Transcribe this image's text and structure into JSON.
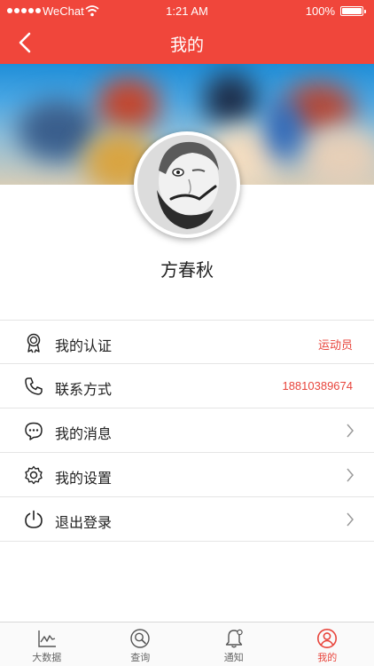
{
  "status_bar": {
    "carrier": "WeChat",
    "time": "1:21 AM",
    "battery": "100%"
  },
  "nav": {
    "title": "我的"
  },
  "profile": {
    "name": "方春秋"
  },
  "menu": {
    "items": [
      {
        "label": "我的认证",
        "value": "运动员",
        "icon": "certificate-icon"
      },
      {
        "label": "联系方式",
        "value": "18810389674",
        "icon": "phone-icon"
      },
      {
        "label": "我的消息",
        "value": "",
        "icon": "message-icon"
      },
      {
        "label": "我的设置",
        "value": "",
        "icon": "gear-icon"
      },
      {
        "label": "退出登录",
        "value": "",
        "icon": "power-icon"
      }
    ]
  },
  "tabs": [
    {
      "label": "大数据",
      "icon": "chart-icon",
      "active": false
    },
    {
      "label": "查询",
      "icon": "search-icon",
      "active": false
    },
    {
      "label": "通知",
      "icon": "bell-icon",
      "active": false
    },
    {
      "label": "我的",
      "icon": "user-icon",
      "active": true
    }
  ],
  "colors": {
    "accent": "#f0463b",
    "value_text": "#e8453c"
  }
}
